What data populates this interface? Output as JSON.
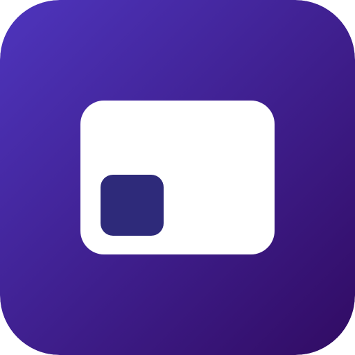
{
  "icon": {
    "name": "picture-in-picture-icon",
    "colors": {
      "background_start": "#4E35BD",
      "background_end": "#310B63",
      "window": "#FFFFFF",
      "mini_window": "#2E2A7A"
    }
  }
}
